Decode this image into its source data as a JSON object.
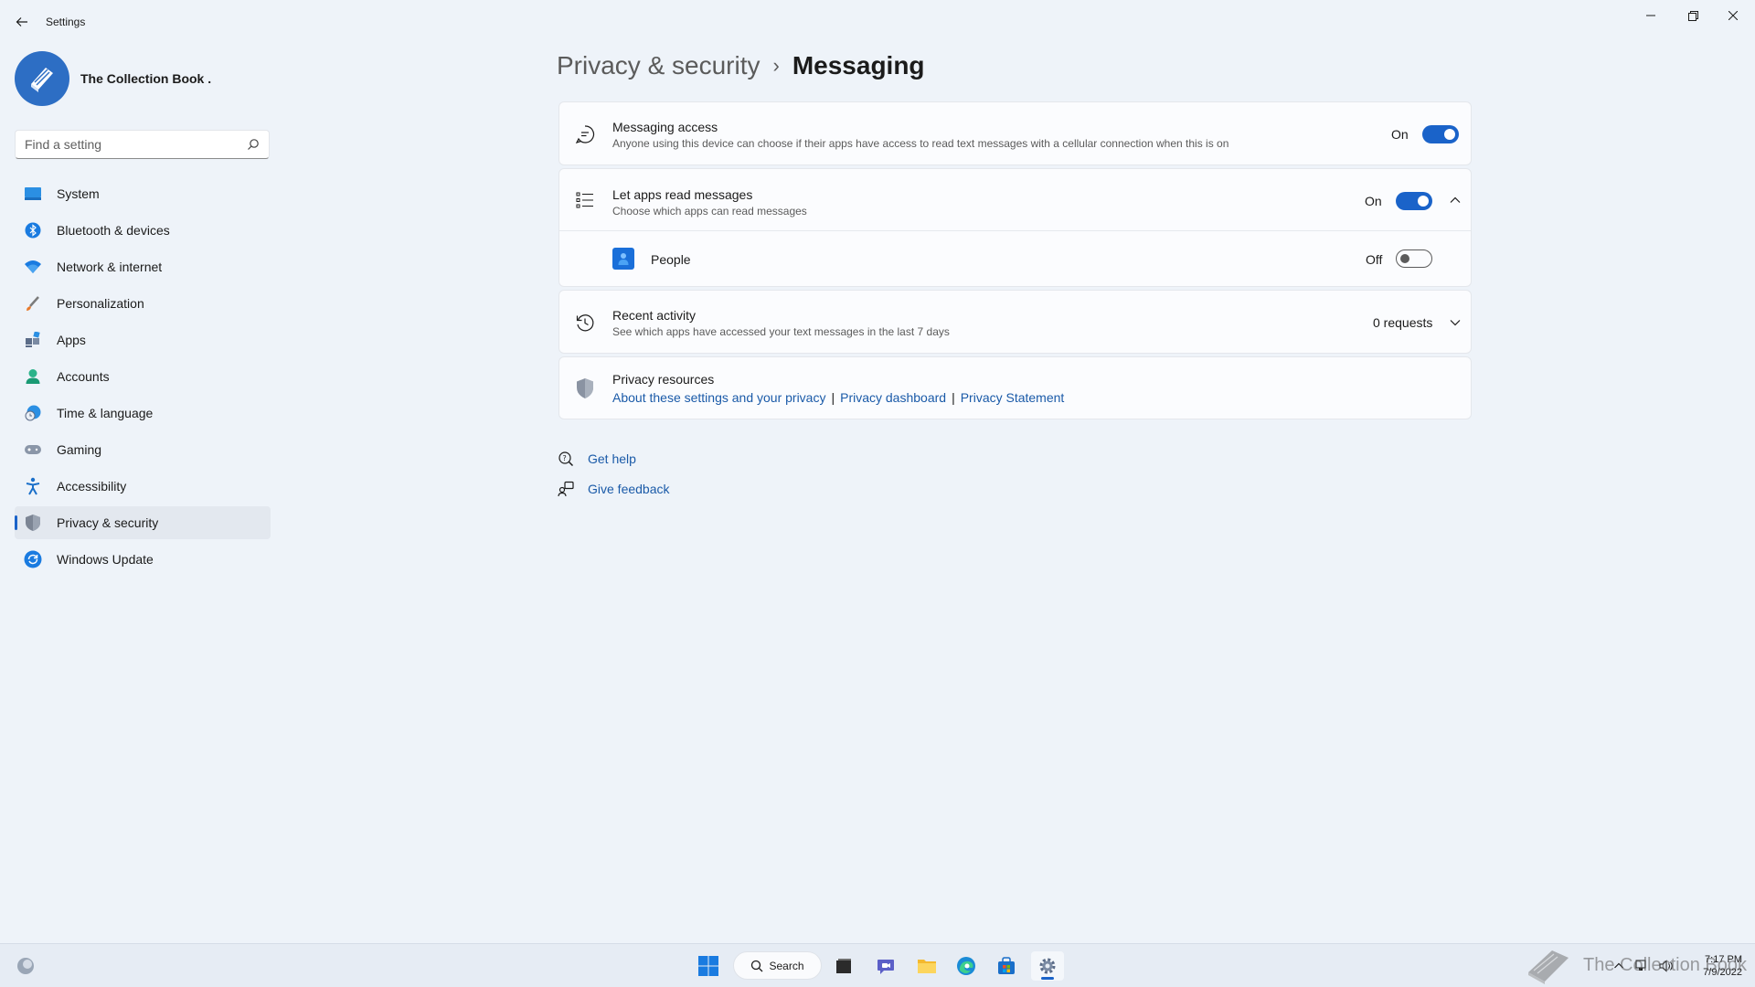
{
  "window": {
    "title": "Settings"
  },
  "profile": {
    "name": "The Collection Book ."
  },
  "search": {
    "placeholder": "Find a setting"
  },
  "sidebar": {
    "items": [
      {
        "label": "System",
        "icon": "system-icon"
      },
      {
        "label": "Bluetooth & devices",
        "icon": "bluetooth-icon"
      },
      {
        "label": "Network & internet",
        "icon": "wifi-icon"
      },
      {
        "label": "Personalization",
        "icon": "brush-icon"
      },
      {
        "label": "Apps",
        "icon": "apps-icon"
      },
      {
        "label": "Accounts",
        "icon": "account-icon"
      },
      {
        "label": "Time & language",
        "icon": "globe-clock-icon"
      },
      {
        "label": "Gaming",
        "icon": "controller-icon"
      },
      {
        "label": "Accessibility",
        "icon": "accessibility-icon"
      },
      {
        "label": "Privacy & security",
        "icon": "shield-icon",
        "active": true
      },
      {
        "label": "Windows Update",
        "icon": "update-icon"
      }
    ]
  },
  "breadcrumb": {
    "parent": "Privacy & security",
    "separator": "›",
    "current": "Messaging"
  },
  "messaging_access": {
    "title": "Messaging access",
    "subtitle": "Anyone using this device can choose if their apps have access to read text messages with a cellular connection when this is on",
    "state_label": "On",
    "enabled": true
  },
  "let_apps": {
    "title": "Let apps read messages",
    "subtitle": "Choose which apps can read messages",
    "state_label": "On",
    "enabled": true,
    "expanded": true,
    "apps": [
      {
        "name": "People",
        "state_label": "Off",
        "enabled": false
      }
    ]
  },
  "recent_activity": {
    "title": "Recent activity",
    "subtitle": "See which apps have accessed your text messages in the last 7 days",
    "count_label": "0 requests"
  },
  "privacy_resources": {
    "title": "Privacy resources",
    "links": [
      "About these settings and your privacy",
      "Privacy dashboard",
      "Privacy Statement"
    ],
    "separator": "|"
  },
  "help": {
    "get_help": "Get help",
    "give_feedback": "Give feedback"
  },
  "taskbar": {
    "search_label": "Search",
    "time": "7:17 PM",
    "date": "7/9/2022",
    "watermark": "The Collection Book"
  },
  "colors": {
    "accent": "#1a63c9",
    "background": "#eef3f9",
    "card": "#fbfcfe",
    "link": "#1a5aa8"
  }
}
